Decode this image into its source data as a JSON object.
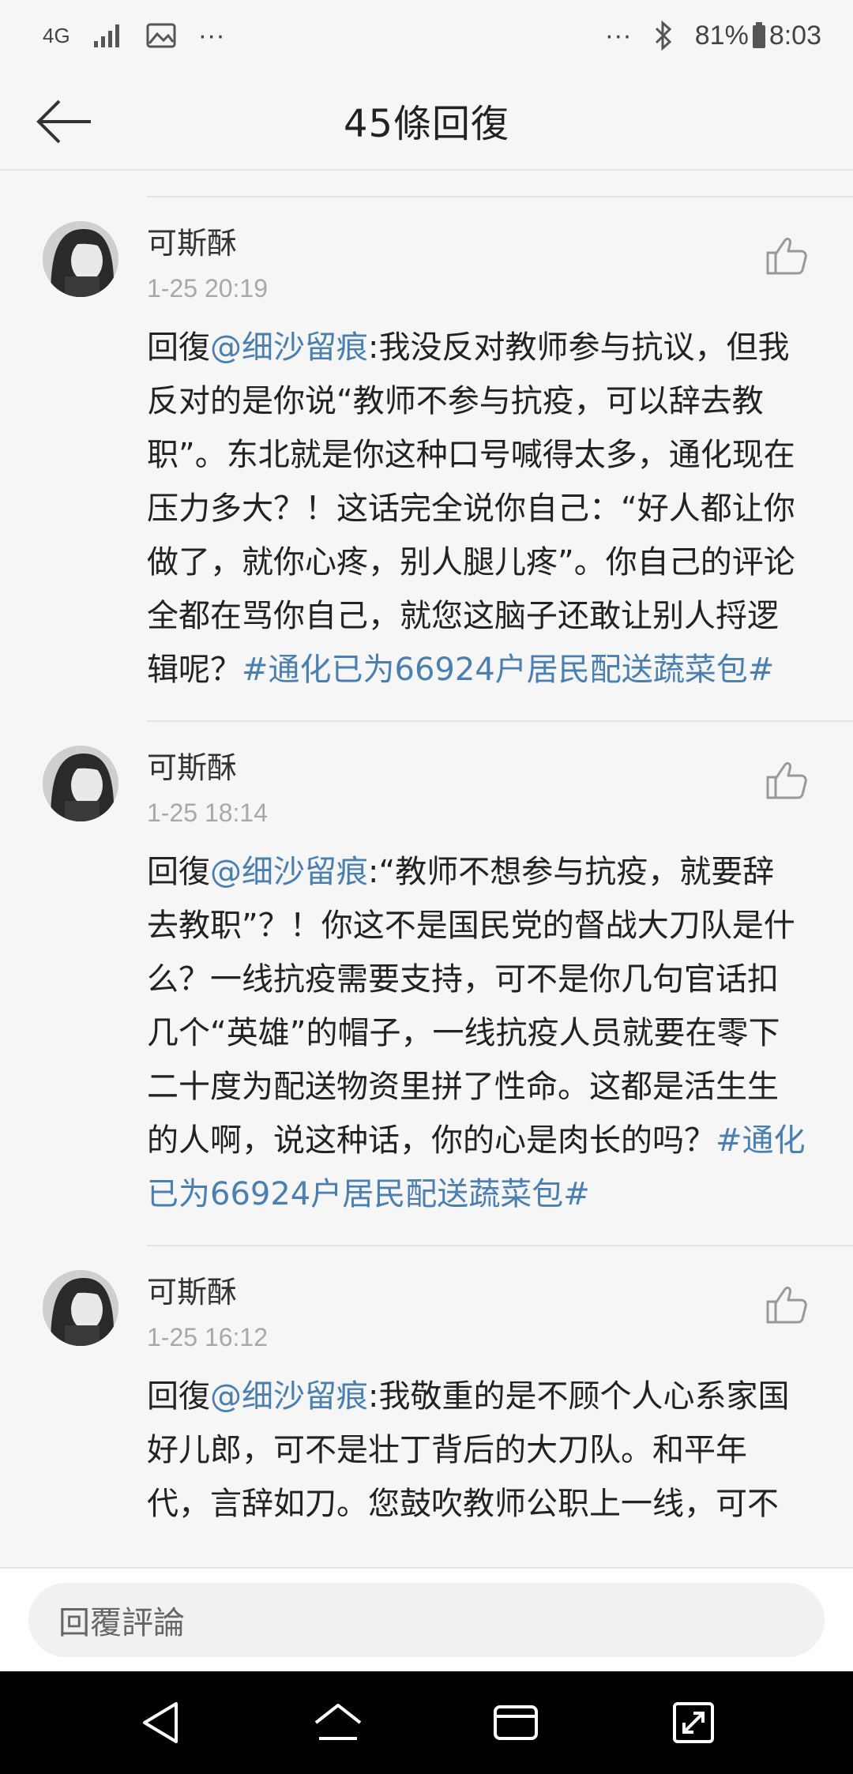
{
  "status_bar": {
    "network": "4G",
    "more_left": "···",
    "more_right": "···",
    "battery": "81%",
    "time": "8:03"
  },
  "header": {
    "title": "45條回復"
  },
  "comments": [
    {
      "username": "可斯酥",
      "time": "1-25 20:19",
      "reply_prefix": "回復",
      "mention": "@细沙留痕",
      "text": ":我没反对教师参与抗议，但我反对的是你说“教师不参与抗疫，可以辞去教职”。东北就是你这种口号喊得太多，通化现在压力多大？！这话完全说你自己：“好人都让你做了，就你心疼，别人腿儿疼”。你自己的评论全都在骂你自己，就您这脑子还敢让别人捋逻辑呢？",
      "hashtag": "#通化已为66924户居民配送蔬菜包#"
    },
    {
      "username": "可斯酥",
      "time": "1-25 18:14",
      "reply_prefix": "回復",
      "mention": "@细沙留痕",
      "text": ":“教师不想参与抗疫，就要辞去教职”？！你这不是国民党的督战大刀队是什么？一线抗疫需要支持，可不是你几句官话扣几个“英雄”的帽子，一线抗疫人员就要在零下二十度为配送物资里拼了性命。这都是活生生的人啊，说这种话，你的心是肉长的吗？",
      "hashtag": "#通化已为66924户居民配送蔬菜包#"
    },
    {
      "username": "可斯酥",
      "time": "1-25 16:12",
      "reply_prefix": "回復",
      "mention": "@细沙留痕",
      "text": ":我敬重的是不顾个人心系家国好儿郎，可不是壮丁背后的大刀队。和平年代，言辞如刀。您鼓吹教师公职上一线，可不",
      "hashtag": ""
    }
  ],
  "reply_bar": {
    "placeholder": "回覆評論"
  },
  "colors": {
    "link": "#4a7fb0",
    "timestamp": "#a8a8a8",
    "background": "#f6f6f6"
  },
  "icons": {
    "back": "arrow-left-icon",
    "like": "thumbs-up-icon",
    "nav": [
      "back-triangle-icon",
      "home-icon",
      "recents-icon",
      "expand-icon"
    ]
  }
}
